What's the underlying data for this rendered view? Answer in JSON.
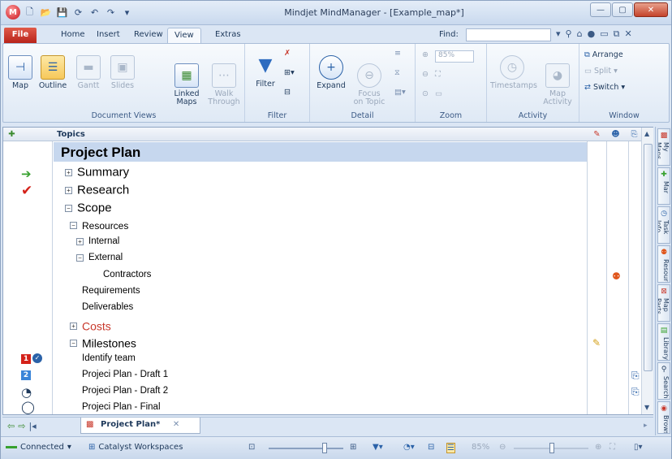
{
  "window": {
    "title": "Mindjet MindManager - [Example_map*]",
    "controls": {
      "minimize": "—",
      "maximize": "▢",
      "close": "✕"
    }
  },
  "quick_access": [
    "new",
    "open",
    "save",
    "redo-history",
    "undo",
    "redo",
    "customize"
  ],
  "tabs": [
    {
      "label": "File",
      "type": "file"
    },
    {
      "label": "Home"
    },
    {
      "label": "Insert"
    },
    {
      "label": "Review"
    },
    {
      "label": "View",
      "active": true
    },
    {
      "label": "Extras"
    }
  ],
  "find": {
    "label": "Find:",
    "value": ""
  },
  "ribbon": {
    "document_views": {
      "label": "Document Views",
      "buttons": [
        {
          "label": "Map"
        },
        {
          "label": "Outline",
          "selected": true
        },
        {
          "label": "Gantt",
          "disabled": true
        },
        {
          "label": "Slides",
          "disabled": true
        },
        {
          "label": "Linked\nMaps"
        },
        {
          "label": "Walk\nThrough",
          "disabled": true
        }
      ]
    },
    "filter": {
      "label": "Filter",
      "button": "Filter"
    },
    "detail": {
      "label": "Detail",
      "buttons": [
        {
          "label": "Expand"
        },
        {
          "label": "Focus\non Topic",
          "disabled": true
        }
      ]
    },
    "zoom": {
      "label": "Zoom",
      "value": "85%"
    },
    "activity": {
      "label": "Activity",
      "buttons": [
        {
          "label": "Timestamps",
          "disabled": true
        },
        {
          "label": "Map\nActivity",
          "disabled": true
        }
      ]
    },
    "window": {
      "label": "Window",
      "buttons": [
        "Arrange",
        "Split",
        "Switch"
      ]
    }
  },
  "outline": {
    "column_header": "Topics",
    "root": "Project Plan",
    "rows": [
      {
        "text": "Summary",
        "level": 1,
        "expander": "+",
        "marker": "arrow-green"
      },
      {
        "text": "Research",
        "level": 1,
        "expander": "+",
        "marker": "check-red"
      },
      {
        "text": "Scope",
        "level": 1,
        "expander": "−"
      },
      {
        "text": "Resources",
        "level": 2,
        "expander": "−"
      },
      {
        "text": "Internal",
        "level": 3,
        "expander": "+"
      },
      {
        "text": "External",
        "level": 3,
        "expander": "−"
      },
      {
        "text": "Contractors",
        "level": 4,
        "col2_icon": "resource-icon"
      },
      {
        "text": "Requirements",
        "level": 2
      },
      {
        "text": "Deliverables",
        "level": 2
      },
      {
        "text": "Costs",
        "level": 1,
        "expander": "+",
        "red": true
      },
      {
        "text": "Milestones",
        "level": 1,
        "expander": "−",
        "col1_icon": "note-icon"
      },
      {
        "text": "Identify team",
        "level": 2,
        "marker": "priority-1"
      },
      {
        "text": "Projeci Plan - Draft 1",
        "level": 2,
        "marker": "priority-2",
        "col3_icon": "attachment-icon"
      },
      {
        "text": "Projeci Plan - Draft 2",
        "level": 2,
        "marker": "progress-quarter",
        "col3_icon": "attachment-icon"
      },
      {
        "text": "Projeci Plan - Final",
        "level": 2,
        "marker": "progress-empty"
      }
    ]
  },
  "doc_tab": {
    "label": "Project Plan*",
    "close": "✕"
  },
  "statusbar": {
    "connection": "Connected",
    "workspace": "Catalyst Workspaces",
    "zoom_pct": "85%"
  },
  "sidepanel": [
    "My Maps",
    "Mar",
    "Task Info",
    "Resources",
    "Map Parts",
    "Library",
    "Search",
    "Browser"
  ],
  "colors": {
    "accent": "#c8372a",
    "selection": "#c6d7ee",
    "ribbon_bg": "#dfe9f5"
  }
}
